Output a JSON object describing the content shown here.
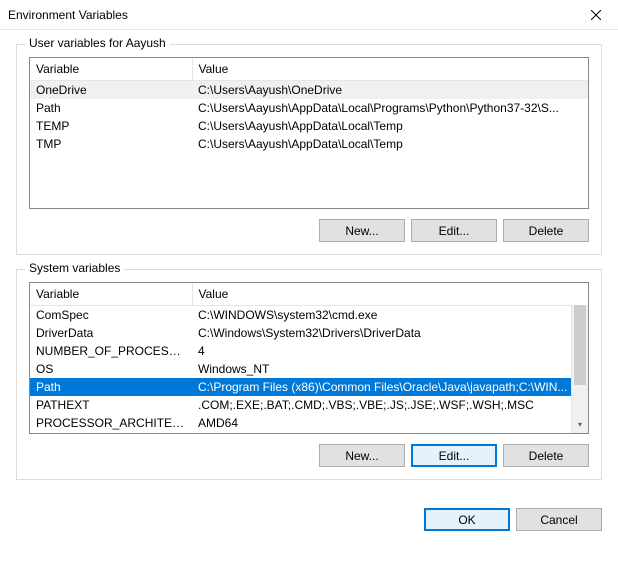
{
  "window": {
    "title": "Environment Variables"
  },
  "user_section": {
    "label": "User variables for Aayush",
    "columns": {
      "variable": "Variable",
      "value": "Value"
    },
    "rows": [
      {
        "variable": "OneDrive",
        "value": "C:\\Users\\Aayush\\OneDrive",
        "state": "inactive-sel"
      },
      {
        "variable": "Path",
        "value": "C:\\Users\\Aayush\\AppData\\Local\\Programs\\Python\\Python37-32\\S..."
      },
      {
        "variable": "TEMP",
        "value": "C:\\Users\\Aayush\\AppData\\Local\\Temp"
      },
      {
        "variable": "TMP",
        "value": "C:\\Users\\Aayush\\AppData\\Local\\Temp"
      }
    ],
    "buttons": {
      "new": "New...",
      "edit": "Edit...",
      "delete": "Delete"
    }
  },
  "system_section": {
    "label": "System variables",
    "columns": {
      "variable": "Variable",
      "value": "Value"
    },
    "rows": [
      {
        "variable": "ComSpec",
        "value": "C:\\WINDOWS\\system32\\cmd.exe"
      },
      {
        "variable": "DriverData",
        "value": "C:\\Windows\\System32\\Drivers\\DriverData"
      },
      {
        "variable": "NUMBER_OF_PROCESSORS",
        "value": "4"
      },
      {
        "variable": "OS",
        "value": "Windows_NT"
      },
      {
        "variable": "Path",
        "value": "C:\\Program Files (x86)\\Common Files\\Oracle\\Java\\javapath;C:\\WIN...",
        "state": "selected"
      },
      {
        "variable": "PATHEXT",
        "value": ".COM;.EXE;.BAT;.CMD;.VBS;.VBE;.JS;.JSE;.WSF;.WSH;.MSC"
      },
      {
        "variable": "PROCESSOR_ARCHITECTURE",
        "value": "AMD64"
      }
    ],
    "buttons": {
      "new": "New...",
      "edit": "Edit...",
      "delete": "Delete"
    }
  },
  "dialog_buttons": {
    "ok": "OK",
    "cancel": "Cancel"
  }
}
